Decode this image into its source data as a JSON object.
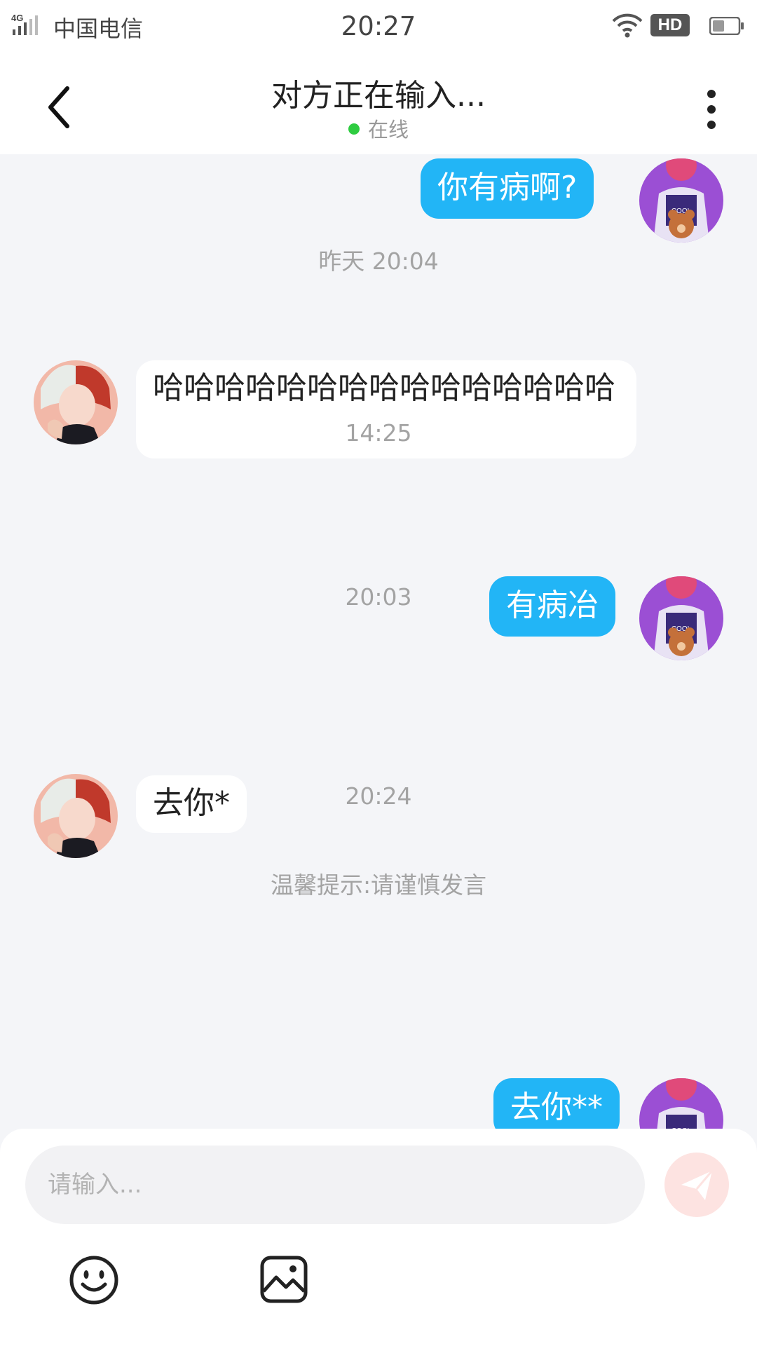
{
  "status_bar": {
    "network": "4G",
    "carrier": "中国电信",
    "time": "20:27",
    "hd_label": "HD",
    "icons": [
      "signal-icon",
      "wifi-icon",
      "battery-icon"
    ]
  },
  "header": {
    "title": "对方正在输入...",
    "status": "在线",
    "status_color": "#2ecc40",
    "icons": [
      "back-arrow-icon",
      "more-vertical-icon"
    ]
  },
  "chat": {
    "messages": [
      {
        "type": "outgoing",
        "text": "你有病啊?"
      },
      {
        "type": "timestamp",
        "text": "昨天 20:04"
      },
      {
        "type": "incoming",
        "text": "哈哈哈哈哈哈哈哈哈哈哈哈哈哈哈"
      },
      {
        "type": "timestamp",
        "text": "14:25"
      },
      {
        "type": "outgoing",
        "text": "有病冶"
      },
      {
        "type": "timestamp",
        "text": "20:03"
      },
      {
        "type": "incoming",
        "text": "去你*"
      },
      {
        "type": "timestamp",
        "text": "20:24"
      },
      {
        "type": "tip",
        "text": "温馨提示:请谨慎发言"
      },
      {
        "type": "outgoing",
        "text": "去你**"
      }
    ],
    "outgoing_bubble_color": "#22b5f6",
    "incoming_bubble_color": "#ffffff",
    "avatar_labels": {
      "self_jacket_text": "COOL"
    }
  },
  "input": {
    "placeholder": "请输入...",
    "value": "",
    "icons": [
      "send-icon",
      "emoji-icon",
      "image-icon"
    ],
    "send_color": "#fde3e1"
  }
}
